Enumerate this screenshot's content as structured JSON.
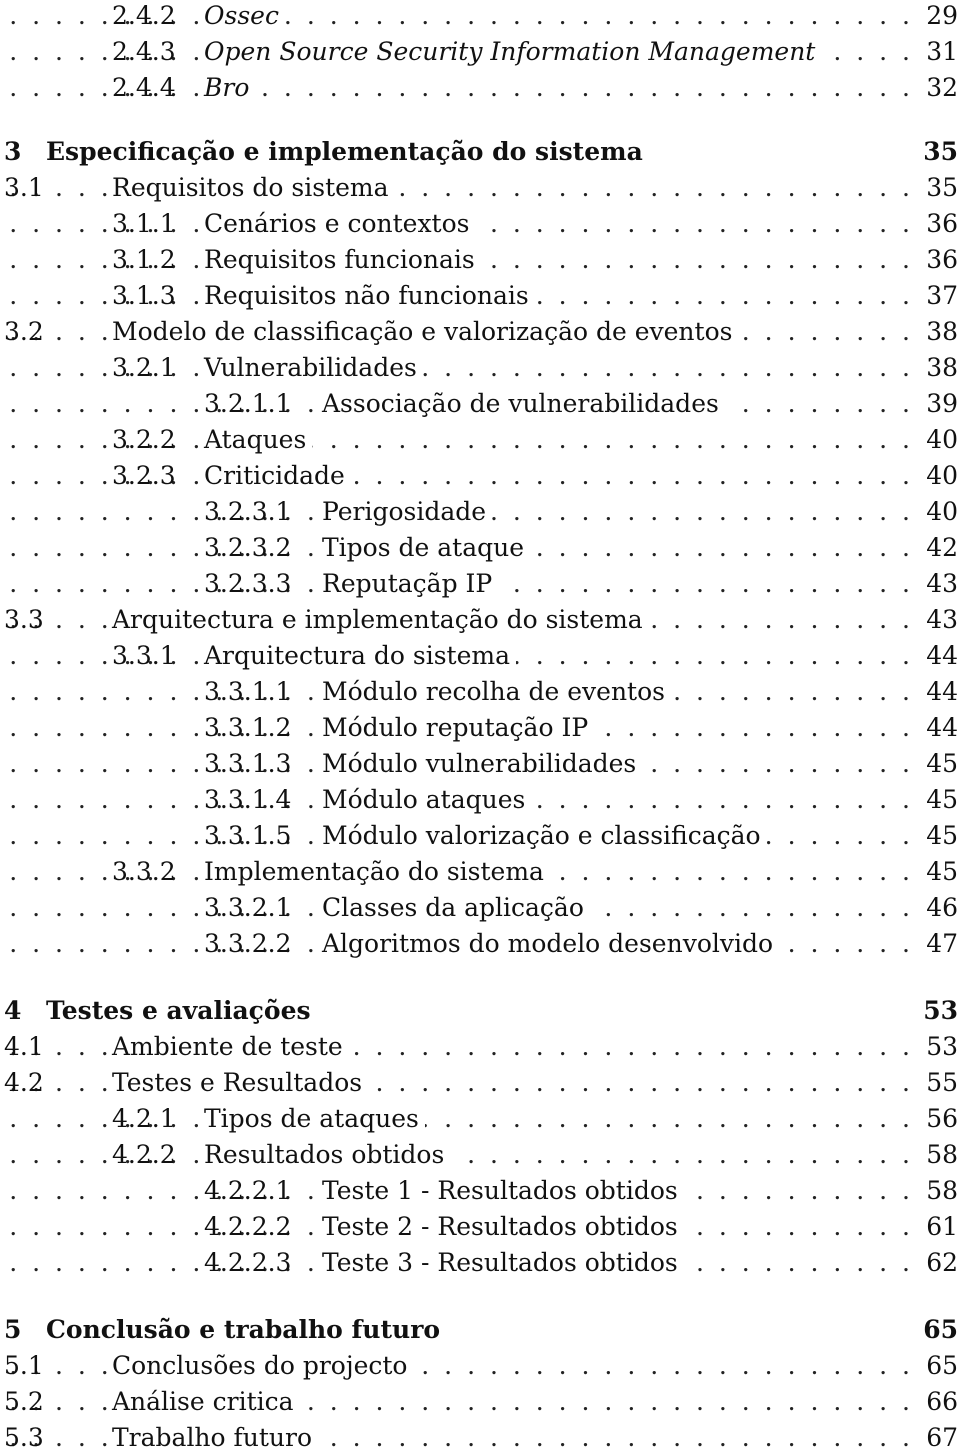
{
  "toc": [
    {
      "level": 3,
      "num": "2.4.2",
      "title": "Ossec",
      "page": "29",
      "italic": true
    },
    {
      "level": 3,
      "num": "2.4.3",
      "title": "Open Source Security Information Management",
      "page": "31",
      "italic": true
    },
    {
      "level": 3,
      "num": "2.4.4",
      "title": "Bro",
      "page": "32",
      "italic": true
    },
    {
      "level": 1,
      "num": "3",
      "title": "Especificação e implementação do sistema",
      "page": "35"
    },
    {
      "level": 2,
      "num": "3.1",
      "title": "Requisitos do sistema",
      "page": "35"
    },
    {
      "level": 3,
      "num": "3.1.1",
      "title": "Cenários e contextos",
      "page": "36"
    },
    {
      "level": 3,
      "num": "3.1.2",
      "title": "Requisitos funcionais",
      "page": "36"
    },
    {
      "level": 3,
      "num": "3.1.3",
      "title": "Requisitos não funcionais",
      "page": "37"
    },
    {
      "level": 2,
      "num": "3.2",
      "title": "Modelo de classificação e valorização de eventos",
      "page": "38"
    },
    {
      "level": 3,
      "num": "3.2.1",
      "title": "Vulnerabilidades",
      "page": "38"
    },
    {
      "level": 4,
      "num": "3.2.1.1",
      "title": "Associação de vulnerabilidades",
      "page": "39"
    },
    {
      "level": 3,
      "num": "3.2.2",
      "title": "Ataques",
      "page": "40"
    },
    {
      "level": 3,
      "num": "3.2.3",
      "title": "Criticidade",
      "page": "40"
    },
    {
      "level": 4,
      "num": "3.2.3.1",
      "title": "Perigosidade",
      "page": "40"
    },
    {
      "level": 4,
      "num": "3.2.3.2",
      "title": "Tipos de ataque",
      "page": "42"
    },
    {
      "level": 4,
      "num": "3.2.3.3",
      "title": "Reputaçãp IP",
      "page": "43"
    },
    {
      "level": 2,
      "num": "3.3",
      "title": "Arquitectura e implementação do sistema",
      "page": "43"
    },
    {
      "level": 3,
      "num": "3.3.1",
      "title": "Arquitectura do sistema",
      "page": "44"
    },
    {
      "level": 4,
      "num": "3.3.1.1",
      "title": "Módulo recolha de eventos",
      "page": "44"
    },
    {
      "level": 4,
      "num": "3.3.1.2",
      "title": "Módulo reputação IP",
      "page": "44"
    },
    {
      "level": 4,
      "num": "3.3.1.3",
      "title": "Módulo vulnerabilidades",
      "page": "45"
    },
    {
      "level": 4,
      "num": "3.3.1.4",
      "title": "Módulo ataques",
      "page": "45"
    },
    {
      "level": 4,
      "num": "3.3.1.5",
      "title": "Módulo valorização e classificação",
      "page": "45"
    },
    {
      "level": 3,
      "num": "3.3.2",
      "title": "Implementação do sistema",
      "page": "45"
    },
    {
      "level": 4,
      "num": "3.3.2.1",
      "title": "Classes da aplicação",
      "page": "46"
    },
    {
      "level": 4,
      "num": "3.3.2.2",
      "title": "Algoritmos do modelo desenvolvido",
      "page": "47"
    },
    {
      "level": 1,
      "num": "4",
      "title": "Testes e avaliações",
      "page": "53"
    },
    {
      "level": 2,
      "num": "4.1",
      "title": "Ambiente de teste",
      "page": "53"
    },
    {
      "level": 2,
      "num": "4.2",
      "title": "Testes e Resultados",
      "page": "55"
    },
    {
      "level": 3,
      "num": "4.2.1",
      "title": "Tipos de ataques",
      "page": "56"
    },
    {
      "level": 3,
      "num": "4.2.2",
      "title": "Resultados obtidos",
      "page": "58"
    },
    {
      "level": 4,
      "num": "4.2.2.1",
      "title": "Teste 1 - Resultados obtidos",
      "page": "58"
    },
    {
      "level": 4,
      "num": "4.2.2.2",
      "title": "Teste 2 - Resultados obtidos",
      "page": "61"
    },
    {
      "level": 4,
      "num": "4.2.2.3",
      "title": "Teste 3 - Resultados obtidos",
      "page": "62"
    },
    {
      "level": 1,
      "num": "5",
      "title": "Conclusão e trabalho futuro",
      "page": "65"
    },
    {
      "level": 2,
      "num": "5.1",
      "title": "Conclusões do projecto",
      "page": "65"
    },
    {
      "level": 2,
      "num": "5.2",
      "title": "Análise critica",
      "page": "66"
    },
    {
      "level": 2,
      "num": "5.3",
      "title": "Trabalho futuro",
      "page": "67"
    }
  ]
}
